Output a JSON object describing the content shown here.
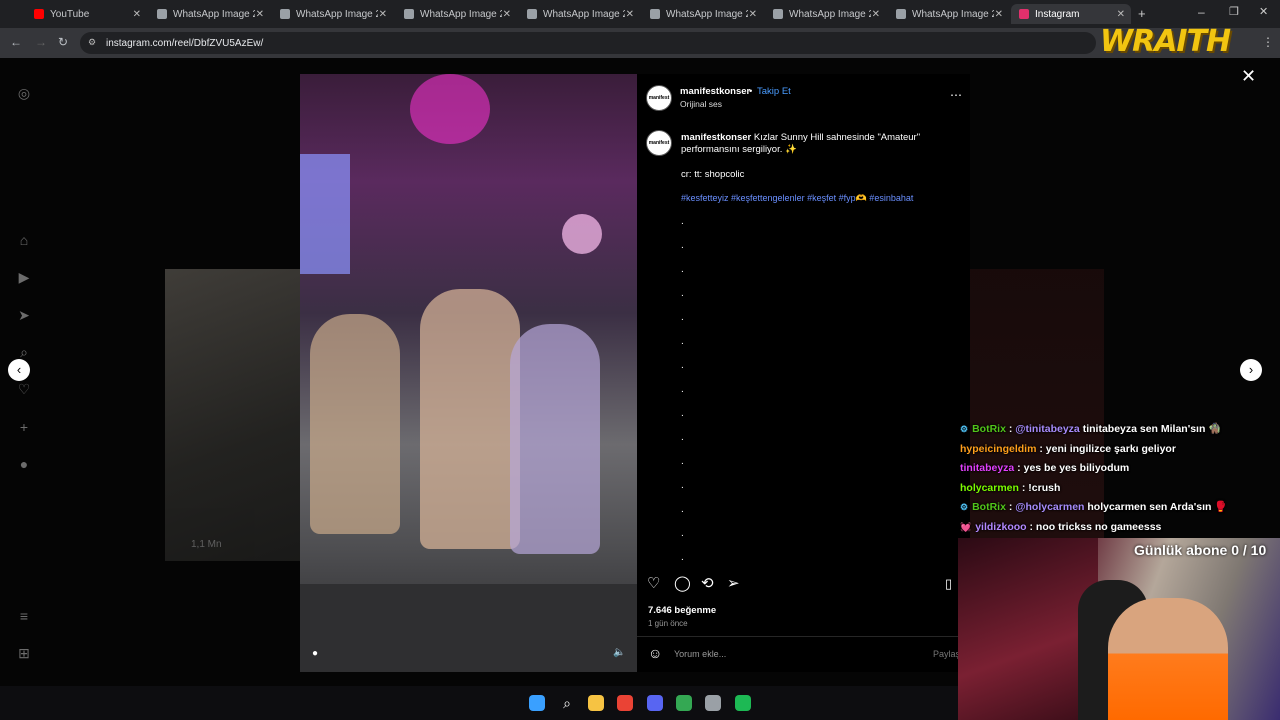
{
  "tabs": [
    {
      "title": "YouTube",
      "icon": "youtube-icon",
      "color": "#ff0000"
    },
    {
      "title": "WhatsApp Image 202",
      "icon": "globe-icon",
      "color": "#9aa0a6"
    },
    {
      "title": "WhatsApp Image 202",
      "icon": "globe-icon",
      "color": "#9aa0a6"
    },
    {
      "title": "WhatsApp Image 202",
      "icon": "globe-icon",
      "color": "#9aa0a6"
    },
    {
      "title": "WhatsApp Image 202",
      "icon": "globe-icon",
      "color": "#9aa0a6"
    },
    {
      "title": "WhatsApp Image 202",
      "icon": "globe-icon",
      "color": "#9aa0a6"
    },
    {
      "title": "WhatsApp Image 202",
      "icon": "globe-icon",
      "color": "#9aa0a6"
    },
    {
      "title": "WhatsApp Image 202",
      "icon": "globe-icon",
      "color": "#9aa0a6"
    },
    {
      "title": "Instagram",
      "icon": "instagram-icon",
      "color": "#e1306c",
      "active": true
    }
  ],
  "address": {
    "url": "instagram.com/reel/DbfZVU5AzEw/"
  },
  "overlay": {
    "brand": "WRAITH"
  },
  "post": {
    "username": "manifestkonser",
    "follow_label": "Takip Et",
    "audio_label": "Orijinal ses",
    "avatar_text": "manifest",
    "caption_user": "manifestkonser",
    "caption_text": "Kızlar Sunny Hill sahnesinde \"Amateur\" performansını sergiliyor. ✨",
    "credit": "cr: tt: shopcolic",
    "hashtags": "#kesfetteyiz #keşfettengelenler #keşfet #fyp🫶 #esinbahat",
    "dots": [
      ".",
      ".",
      ".",
      ".",
      ".",
      ".",
      ".",
      ".",
      ".",
      ".",
      ".",
      ".",
      ".",
      ".",
      "."
    ],
    "likes": "7.646 beğenme",
    "time_ago": "1 gün önce",
    "comment_placeholder": "Yorum ekle...",
    "share_label": "Paylaş"
  },
  "background_post": {
    "views": "1,1 Mn"
  },
  "chat": [
    {
      "badge": "⚙",
      "user": "BotRix",
      "user_color": "#52c41a",
      "text": "@tinitabeyza tinitabeyza sen Milan'sın 🧌",
      "mention": "@tinitabeyza"
    },
    {
      "badge": "",
      "user": "hypeicingeldim",
      "user_color": "#ff9f1c",
      "text": "yeni ingilizce şarkı geliyor",
      "mention": ""
    },
    {
      "badge": "",
      "user": "tinitabeyza",
      "user_color": "#e040fb",
      "text": "yes be yes biliyodum",
      "mention": ""
    },
    {
      "badge": "",
      "user": "holycarmen",
      "user_color": "#7cfc00",
      "text": "!crush",
      "mention": ""
    },
    {
      "badge": "⚙",
      "user": "BotRix",
      "user_color": "#52c41a",
      "text": "@holycarmen holycarmen sen Arda'sın 🥊",
      "mention": "@holycarmen"
    },
    {
      "badge": "💓",
      "user": "yildizkooo",
      "user_color": "#b388ff",
      "text": "noo trickss no gameesss",
      "mention": ""
    }
  ],
  "sub_goal": "Günlük abone 0 / 10",
  "taskbar": [
    {
      "icon": "windows-start-icon",
      "color": "#3aa0ff"
    },
    {
      "icon": "search-icon",
      "color": "#ffffff"
    },
    {
      "icon": "file-explorer-icon",
      "color": "#f6c343"
    },
    {
      "icon": "chrome-icon",
      "color": "#ea4335"
    },
    {
      "icon": "discord-icon",
      "color": "#5865f2"
    },
    {
      "icon": "chrome-icon",
      "color": "#34a853"
    },
    {
      "icon": "steam-icon",
      "color": "#9aa0a6"
    },
    {
      "icon": "spotify-icon",
      "color": "#1db954"
    }
  ]
}
